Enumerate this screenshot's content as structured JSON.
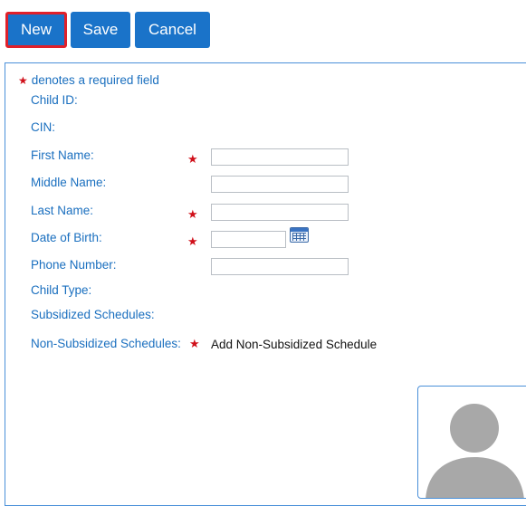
{
  "toolbar": {
    "new_label": "New",
    "save_label": "Save",
    "cancel_label": "Cancel"
  },
  "form": {
    "required_note": "denotes a required field",
    "required_marker": "★",
    "fields": {
      "child_id": {
        "label": "Child ID:"
      },
      "cin": {
        "label": "CIN:"
      },
      "first_name": {
        "label": "First Name:",
        "value": "",
        "required": true
      },
      "middle_name": {
        "label": "Middle Name:",
        "value": ""
      },
      "last_name": {
        "label": "Last Name:",
        "value": "",
        "required": true
      },
      "date_of_birth": {
        "label": "Date of Birth:",
        "value": "",
        "required": true,
        "icon": "calendar-icon"
      },
      "phone_number": {
        "label": "Phone Number:",
        "value": ""
      },
      "child_type": {
        "label": "Child Type:"
      },
      "subsidized_schedules": {
        "label": "Subsidized Schedules:"
      },
      "non_subsidized_schedules": {
        "label": "Non-Subsidized Schedules:",
        "required": true,
        "link": "Add Non-Subsidized Schedule"
      }
    },
    "photo": {
      "icon": "avatar-placeholder-icon"
    }
  },
  "colors": {
    "button_bg": "#1a73c9",
    "active_border": "#e0202a",
    "label": "#1a6fbf",
    "required": "#d0101a",
    "panel_border": "#4a90d9"
  }
}
